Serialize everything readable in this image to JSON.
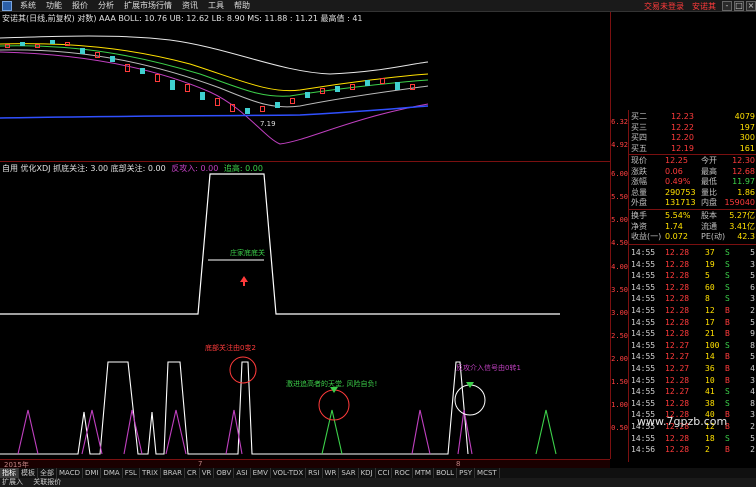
{
  "menu": {
    "items": [
      "系统",
      "功能",
      "报价",
      "分析",
      "扩展市场行情",
      "资讯",
      "工具",
      "帮助"
    ],
    "right_links": [
      "交易未登录",
      "安诺其"
    ],
    "window_buttons": [
      "-",
      "□",
      "×"
    ]
  },
  "upper_chart": {
    "title": "安诺其(日线,前复权) 对数) AAA BOLL: 10.76 UB: 12.62 LB: 8.90 MS: 11.88 : 11.21 最高值 : 41",
    "low_label": "7.19",
    "y_ticks": [
      "6.32",
      "4.92"
    ]
  },
  "indicator": {
    "title_prefix": "自用 优化XDJ 抓底关注: 3.00 底部关注: 0.00",
    "title_mid": "反攻入: 0.00",
    "title_end": "追高: 0.00",
    "annotations": {
      "zhuangjia": "庄家底底关",
      "dibu": "底部关注由0变2",
      "jijin": "激进追高者的天堂, 风险自负!",
      "fangong": "反攻介入信号由0转1"
    },
    "y_ticks": [
      "6.00",
      "5.50",
      "5.00",
      "4.50",
      "4.00",
      "3.50",
      "3.00",
      "2.50",
      "2.00",
      "1.50",
      "1.00",
      "0.50"
    ]
  },
  "quote": {
    "asks": [
      {
        "label": "买二",
        "price": "12.23",
        "vol": "4079"
      },
      {
        "label": "买三",
        "price": "12.22",
        "vol": "197"
      },
      {
        "label": "买四",
        "price": "12.20",
        "vol": "300"
      },
      {
        "label": "买五",
        "price": "12.19",
        "vol": "161"
      }
    ],
    "stats": [
      {
        "l1": "现价",
        "v1": "12.25",
        "l2": "今开",
        "v2": "12.30"
      },
      {
        "l1": "涨跌",
        "v1": "0.06",
        "l2": "最高",
        "v2": "12.68"
      },
      {
        "l1": "涨幅",
        "v1": "0.49%",
        "l2": "最低",
        "v2": "11.97"
      },
      {
        "l1": "总量",
        "v1": "290753",
        "l2": "量比",
        "v2": "1.86"
      },
      {
        "l1": "外盘",
        "v1": "131713",
        "l2": "内盘",
        "v2": "159040"
      }
    ],
    "stats2": [
      {
        "l1": "换手",
        "v1": "5.54%",
        "l2": "股本",
        "v2": "5.27亿"
      },
      {
        "l1": "净资",
        "v1": "1.74",
        "l2": "流通",
        "v2": "3.41亿"
      },
      {
        "l1": "收益(一)",
        "v1": "0.072",
        "l2": "PE(动)",
        "v2": "42.3"
      }
    ],
    "ticks": [
      {
        "time": "14:55",
        "price": "12.28",
        "vol": "37",
        "side": "S",
        "n": "5"
      },
      {
        "time": "14:55",
        "price": "12.28",
        "vol": "19",
        "side": "S",
        "n": "3"
      },
      {
        "time": "14:55",
        "price": "12.28",
        "vol": "5",
        "side": "S",
        "n": "5"
      },
      {
        "time": "14:55",
        "price": "12.28",
        "vol": "60",
        "side": "S",
        "n": "6"
      },
      {
        "time": "14:55",
        "price": "12.28",
        "vol": "8",
        "side": "S",
        "n": "3"
      },
      {
        "time": "14:55",
        "price": "12.28",
        "vol": "12",
        "side": "B",
        "n": "2"
      },
      {
        "time": "14:55",
        "price": "12.28",
        "vol": "17",
        "side": "B",
        "n": "5"
      },
      {
        "time": "14:55",
        "price": "12.28",
        "vol": "21",
        "side": "B",
        "n": "9"
      },
      {
        "time": "14:55",
        "price": "12.27",
        "vol": "100",
        "side": "S",
        "n": "8"
      },
      {
        "time": "14:55",
        "price": "12.27",
        "vol": "14",
        "side": "B",
        "n": "5"
      },
      {
        "time": "14:55",
        "price": "12.27",
        "vol": "36",
        "side": "B",
        "n": "4"
      },
      {
        "time": "14:55",
        "price": "12.28",
        "vol": "10",
        "side": "B",
        "n": "3"
      },
      {
        "time": "14:55",
        "price": "12.27",
        "vol": "41",
        "side": "S",
        "n": "4"
      },
      {
        "time": "14:55",
        "price": "12.28",
        "vol": "38",
        "side": "S",
        "n": "8"
      },
      {
        "time": "14:55",
        "price": "12.28",
        "vol": "40",
        "side": "B",
        "n": "3"
      },
      {
        "time": "14:55",
        "price": "12.28",
        "vol": "12",
        "side": "B",
        "n": "2"
      },
      {
        "time": "14:55",
        "price": "12.28",
        "vol": "18",
        "side": "S",
        "n": "5"
      },
      {
        "time": "14:56",
        "price": "12.28",
        "vol": "2",
        "side": "B",
        "n": "2"
      }
    ]
  },
  "date_strip": {
    "left": "2015年",
    "mid1": "7",
    "mid2": "8"
  },
  "tabs": [
    "指标",
    "模板",
    "全部",
    "MACD",
    "DMI",
    "DMA",
    "FSL",
    "TRIX",
    "BRAR",
    "CR",
    "VR",
    "OBV",
    "ASI",
    "EMV",
    "VOL-TDX",
    "RSI",
    "WR",
    "SAR",
    "KDJ",
    "CCI",
    "ROC",
    "MTM",
    "BOLL",
    "PSY",
    "MCST"
  ],
  "bottom": {
    "left": "扩展入",
    "right": "关联报价"
  },
  "watermark": "www.7gpzb.com",
  "colors": {
    "red": "#ff3b3b",
    "green": "#3cd04a",
    "white": "#ffffff",
    "magenta": "#c040c0",
    "yellow": "#ffe000",
    "cyan": "#40d0d0"
  }
}
